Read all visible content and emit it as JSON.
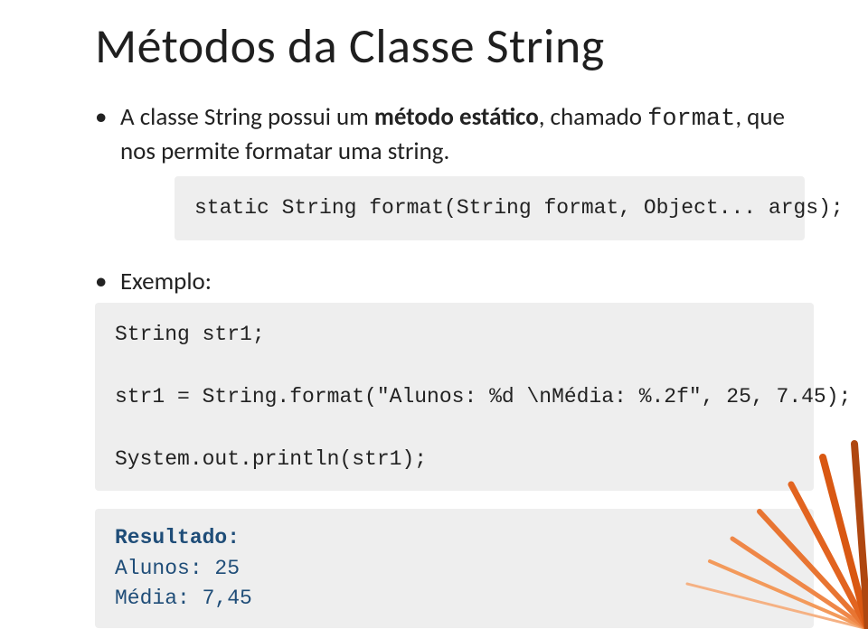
{
  "title": "Métodos da Classe String",
  "bullet1_pre": "A classe String possui um ",
  "bullet1_bold": "método estático",
  "bullet1_mid": ", chamado ",
  "bullet1_mono": "format",
  "bullet1_post": ", que nos permite formatar uma string.",
  "signature": "static String format(String format, Object... args);",
  "bullet2": "Exemplo:",
  "code_line1": "String str1;",
  "code_line2": "str1 = String.format(\"Alunos: %d \\nMédia: %.2f\", 25, 7.45);",
  "code_line3": "System.out.println(str1);",
  "result_label": "Resultado:",
  "result_line1": "Alunos: 25",
  "result_line2": "Média: 7,45"
}
